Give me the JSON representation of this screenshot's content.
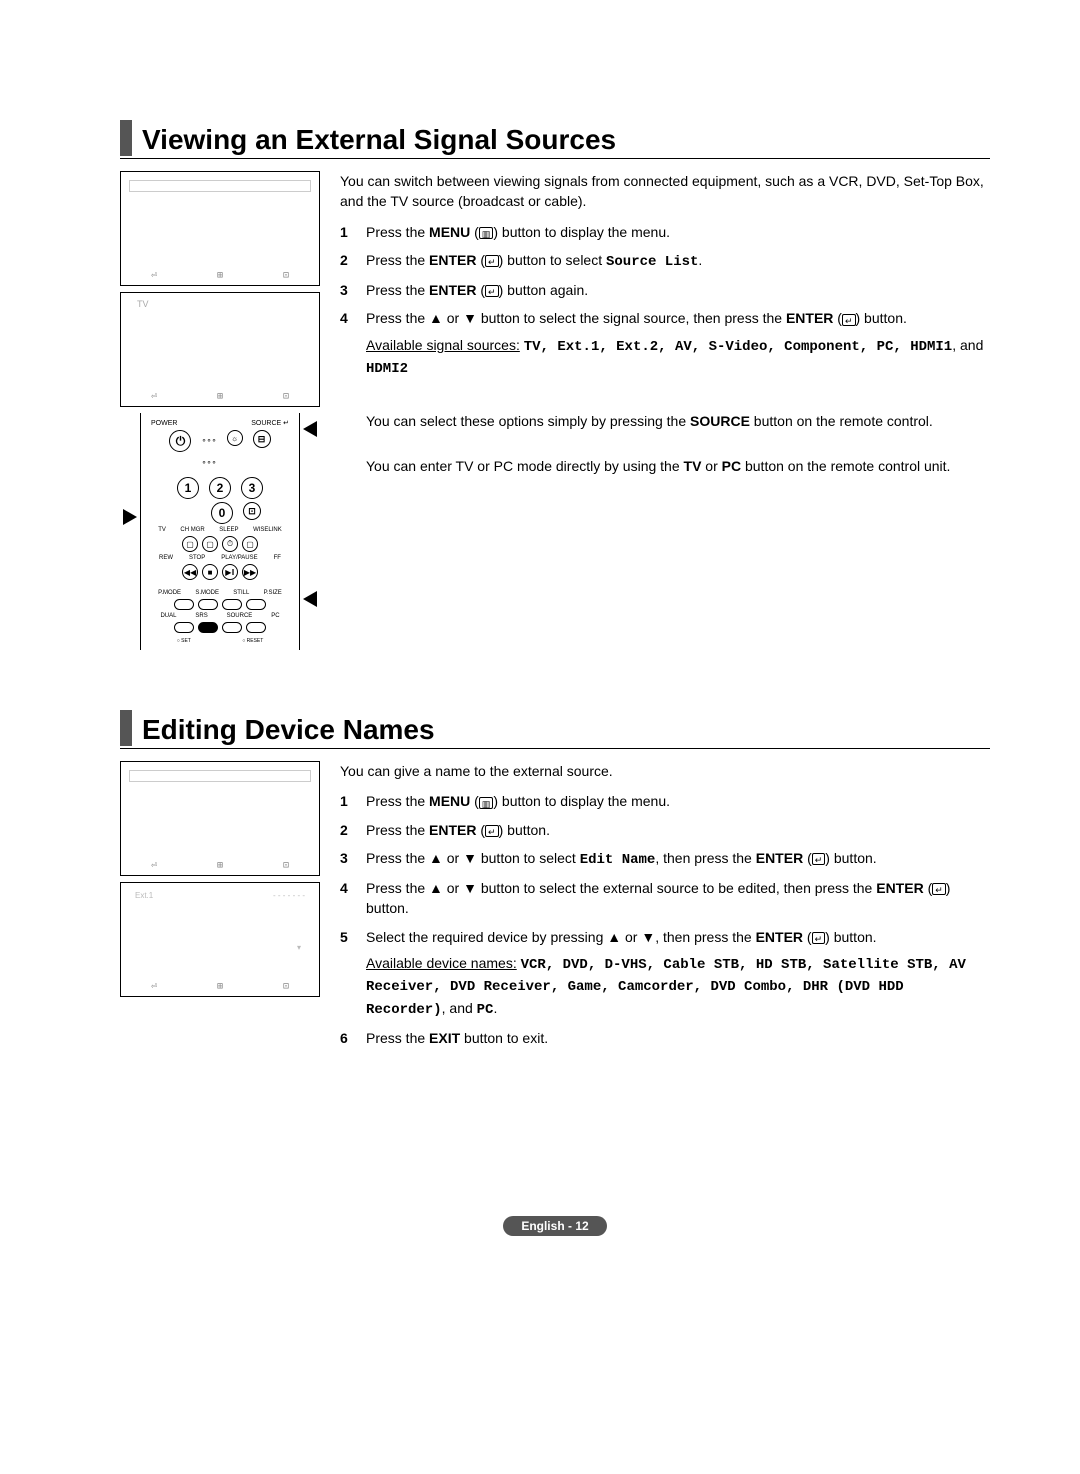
{
  "section1": {
    "title": "Viewing an External Signal Sources",
    "intro": "You can switch between viewing signals from connected equipment, such as a VCR, DVD, Set-Top Box, and the TV source (broadcast or cable).",
    "step1_pre": "Press the ",
    "step1_bold": "MENU",
    "step1_post": " button to display the menu.",
    "step2_pre": "Press the ",
    "step2_bold": "ENTER",
    "step2_mid": " button to select ",
    "step2_code": "Source List",
    "step2_post": ".",
    "step3_pre": "Press the ",
    "step3_bold": "ENTER",
    "step3_post": " button again.",
    "step4_pre": "Press the ▲ or ▼ button to select the signal source, then press the ",
    "step4_bold": "ENTER",
    "step4_post": " button.",
    "sources_intro": "Available signal sources:",
    "sources_list": "TV, Ext.1, Ext.2, AV, S-Video, Component, PC, HDMI1",
    "sources_and": ", and ",
    "sources_last": "HDMI2",
    "note1_pre": "You can select these options simply by pressing the ",
    "note1_bold": "SOURCE",
    "note1_post": " button on the remote control.",
    "note2_pre": "You can enter TV or PC mode directly by using the ",
    "note2_bold1": "TV",
    "note2_mid": " or ",
    "note2_bold2": "PC",
    "note2_post": " button on the remote control unit.",
    "osd2_label": "TV",
    "remote": {
      "power": "POWER",
      "source": "SOURCE",
      "labels_mid": [
        "TV",
        "CH MGR",
        "SLEEP",
        "WISELINK"
      ],
      "labels_play": [
        "REW",
        "STOP",
        "PLAY/PAUSE",
        "FF"
      ],
      "labels_mode": [
        "P.MODE",
        "S.MODE",
        "STILL",
        "P.SIZE"
      ],
      "labels_bot": [
        "DUAL",
        "SRS",
        "SOURCE",
        "PC"
      ],
      "set": "SET",
      "reset": "RESET"
    }
  },
  "section2": {
    "title": "Editing Device Names",
    "intro": "You can give a name to the external source.",
    "step1_pre": "Press the ",
    "step1_bold": "MENU",
    "step1_post": " button to display the menu.",
    "step2_pre": "Press the ",
    "step2_bold": "ENTER",
    "step2_post": " button.",
    "step3_pre": "Press the ▲ or ▼ button to select ",
    "step3_code": "Edit Name",
    "step3_mid": ", then press the ",
    "step3_bold": "ENTER",
    "step3_post": " button.",
    "step4_pre": "Press the ▲ or ▼ button to select the external source to be edited, then press the ",
    "step4_bold": "ENTER",
    "step4_post": " button.",
    "step5_pre": "Select the required device by pressing ▲ or ▼, then press the ",
    "step5_bold": "ENTER",
    "step5_post": " button.",
    "devices_intro": "Available device names:",
    "devices_list": "VCR, DVD, D-VHS, Cable STB, HD STB, Satellite STB, AV Receiver, DVD Receiver, Game, Camcorder, DVD Combo, DHR (DVD HDD Recorder)",
    "devices_and": ", and ",
    "devices_last": "PC",
    "step6_pre": "Press the ",
    "step6_bold": "EXIT",
    "step6_post": " button to exit.",
    "osd2_label": "Ext.1",
    "osd2_right": "- - - - - - -"
  },
  "icons": {
    "menu": "▥",
    "enter": "↵"
  },
  "footer": {
    "lang": "English - ",
    "page": "12"
  },
  "osd_footer_icons": [
    "⏎",
    "⊞",
    "⊡"
  ]
}
